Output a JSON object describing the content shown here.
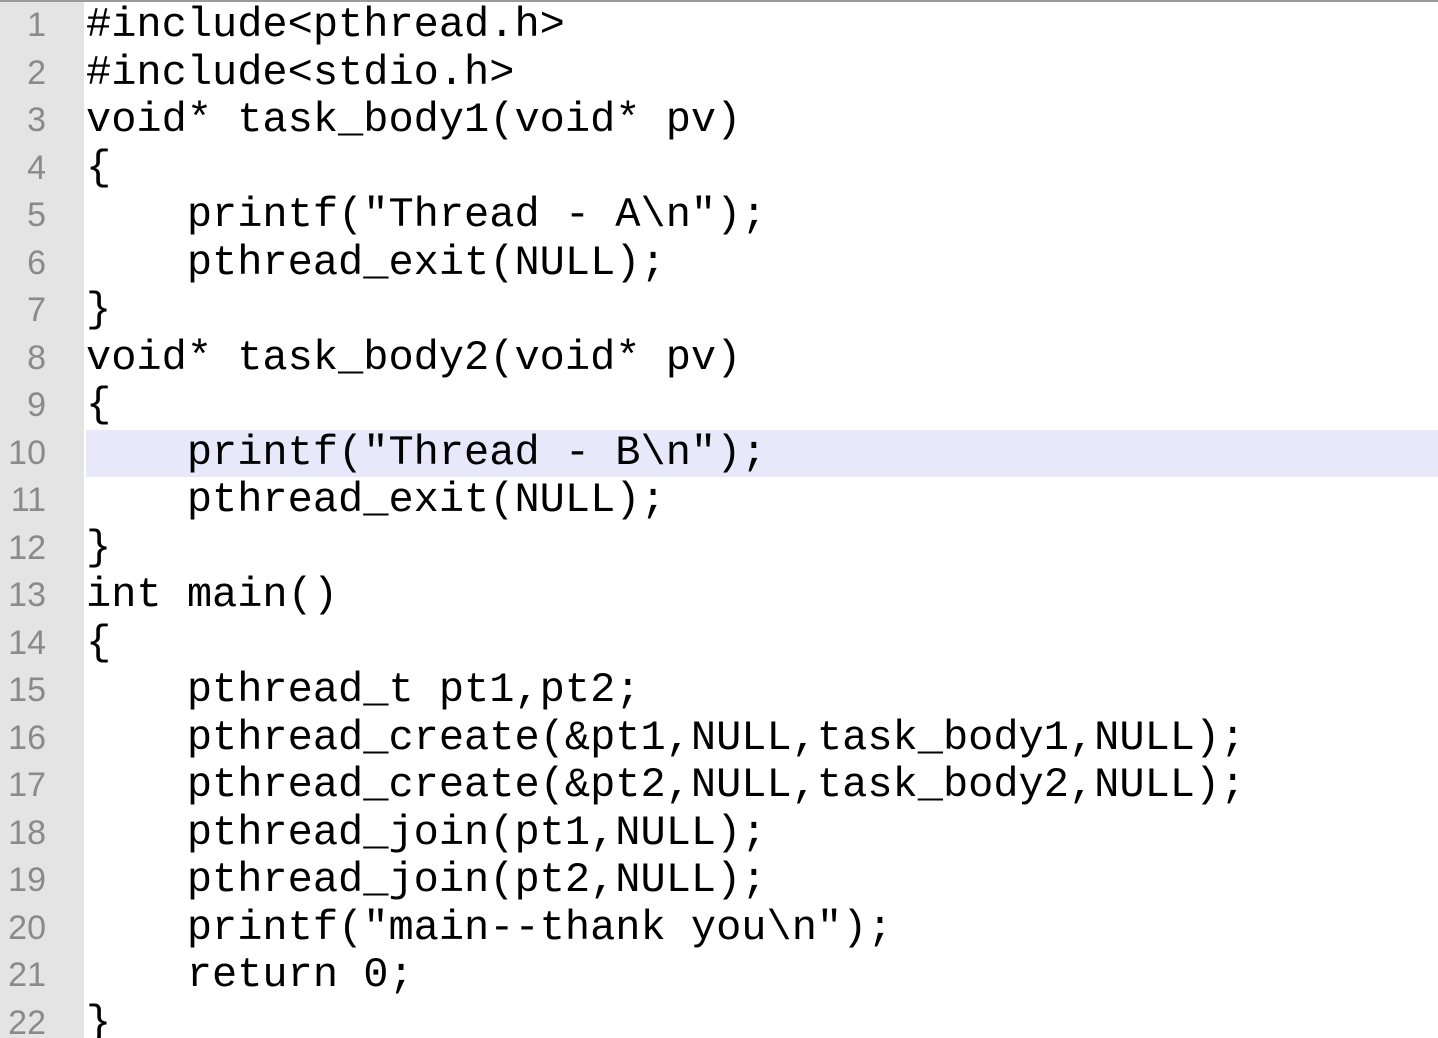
{
  "editor": {
    "current_line_number": "10",
    "lines": [
      {
        "number": "1",
        "text": "#include<pthread.h>"
      },
      {
        "number": "2",
        "text": "#include<stdio.h>"
      },
      {
        "number": "3",
        "text": "void* task_body1(void* pv)"
      },
      {
        "number": "4",
        "text": "{"
      },
      {
        "number": "5",
        "text": "    printf(\"Thread - A\\n\");"
      },
      {
        "number": "6",
        "text": "    pthread_exit(NULL);"
      },
      {
        "number": "7",
        "text": "}"
      },
      {
        "number": "8",
        "text": "void* task_body2(void* pv)"
      },
      {
        "number": "9",
        "text": "{"
      },
      {
        "number": "10",
        "text": "    printf(\"Thread - B\\n\");"
      },
      {
        "number": "11",
        "text": "    pthread_exit(NULL);"
      },
      {
        "number": "12",
        "text": "}"
      },
      {
        "number": "13",
        "text": "int main()"
      },
      {
        "number": "14",
        "text": "{"
      },
      {
        "number": "15",
        "text": "    pthread_t pt1,pt2;"
      },
      {
        "number": "16",
        "text": "    pthread_create(&pt1,NULL,task_body1,NULL);"
      },
      {
        "number": "17",
        "text": "    pthread_create(&pt2,NULL,task_body2,NULL);"
      },
      {
        "number": "18",
        "text": "    pthread_join(pt1,NULL);"
      },
      {
        "number": "19",
        "text": "    pthread_join(pt2,NULL);"
      },
      {
        "number": "20",
        "text": "    printf(\"main--thank you\\n\");"
      },
      {
        "number": "21",
        "text": "    return 0;"
      },
      {
        "number": "22",
        "text": "}"
      }
    ]
  }
}
